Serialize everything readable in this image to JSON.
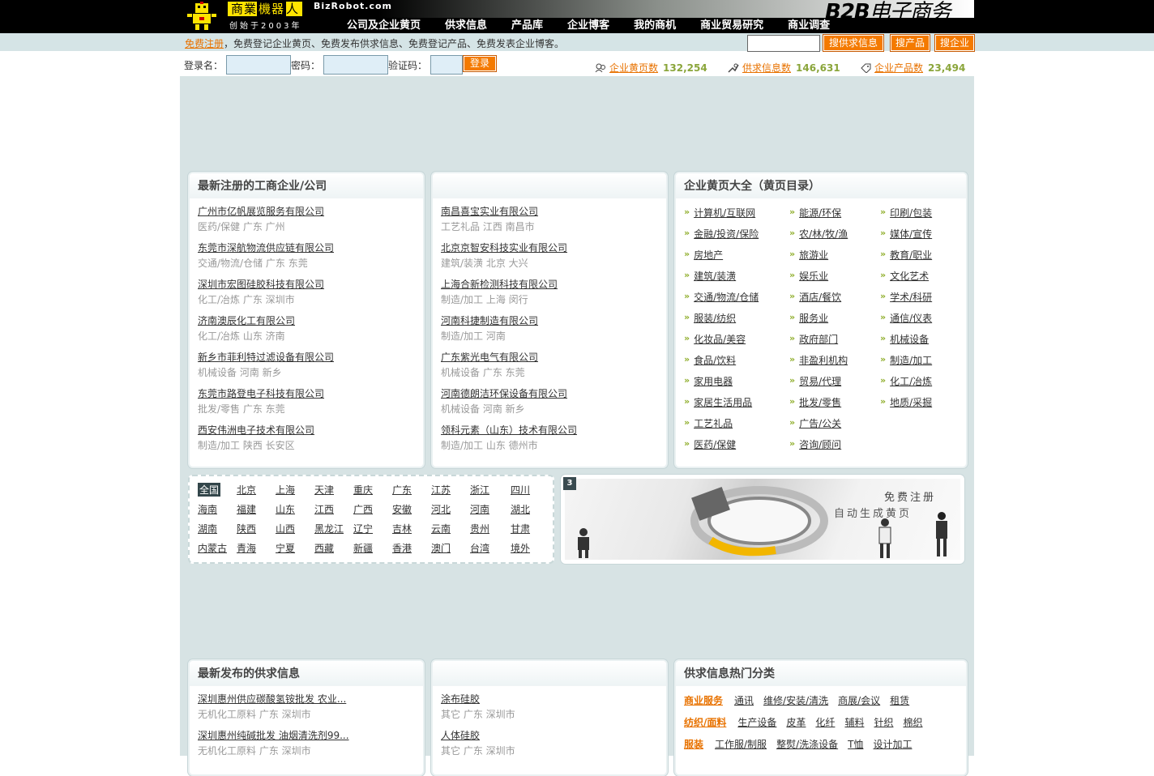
{
  "header": {
    "logo_cn_a": "商業",
    "logo_cn_b": "機器",
    "logo_cn_c": "人",
    "logo_en": "BizRobot.com",
    "logo_sub": "创始于2003年",
    "b2b_a": "B2B",
    "b2b_b": "电子商务",
    "nav": [
      "公司及企业黄页",
      "供求信息",
      "产品库",
      "企业博客",
      "我的商机",
      "商业贸易研究",
      "商业调查"
    ]
  },
  "subbar": {
    "register_link": "免费注册",
    "notice": "，免费登记企业黄页、免费发布供求信息、免费登记产品、免费发表企业博客。",
    "search_placeholder": "",
    "btn_supply": "搜供求信息",
    "btn_product": "搜产品",
    "btn_company": "搜企业"
  },
  "login": {
    "user_label": "登录名：",
    "pass_label": "密码：",
    "code_label": "验证码：",
    "button": "登录"
  },
  "stats": [
    {
      "label": "企业黄页数",
      "value": "132,254"
    },
    {
      "label": "供求信息数",
      "value": "146,631"
    },
    {
      "label": "企业产品数",
      "value": "23,494"
    }
  ],
  "new_companies": {
    "title": "最新注册的工商企业/公司",
    "col1": [
      {
        "name": "广州市亿帆展览服务有限公司",
        "meta": "医药/保健 广东 广州"
      },
      {
        "name": "东莞市深航物流供应链有限公司",
        "meta": "交通/物流/仓储 广东 东莞"
      },
      {
        "name": "深圳市宏图硅胶科技有限公司",
        "meta": "化工/冶炼 广东 深圳市"
      },
      {
        "name": "济南澳辰化工有限公司",
        "meta": "化工/冶炼 山东 济南"
      },
      {
        "name": "新乡市菲利特过滤设备有限公司",
        "meta": "机械设备 河南 新乡"
      },
      {
        "name": "东莞市路登电子科技有限公司",
        "meta": "批发/零售 广东 东莞"
      },
      {
        "name": "西安伟洲电子技术有限公司",
        "meta": "制造/加工 陕西 长安区"
      }
    ],
    "col2": [
      {
        "name": "南昌喜宝实业有限公司",
        "meta": "工艺礼品 江西 南昌市"
      },
      {
        "name": "北京京智安科技实业有限公司",
        "meta": "建筑/装潢 北京 大兴"
      },
      {
        "name": "上海合新检测科技有限公司",
        "meta": "制造/加工 上海 闵行"
      },
      {
        "name": "河南科捷制造有限公司",
        "meta": "制造/加工 河南"
      },
      {
        "name": "广东紫光电气有限公司",
        "meta": "机械设备 广东 东莞"
      },
      {
        "name": "河南德朗洁环保设备有限公司",
        "meta": "机械设备 河南 新乡"
      },
      {
        "name": "领科元素（山东）技术有限公司",
        "meta": "制造/加工 山东 德州市"
      }
    ]
  },
  "directory": {
    "title": "企业黄页大全（黄页目录）",
    "col1": [
      "计算机/互联网",
      "金融/投资/保险",
      "房地产",
      "建筑/装潢",
      "交通/物流/仓储",
      "服装/纺织",
      "化妆品/美容",
      "食品/饮料",
      "家用电器",
      "家居生活用品",
      "工艺礼品",
      "医药/保健"
    ],
    "col2": [
      "能源/环保",
      "农/林/牧/渔",
      "旅游业",
      "娱乐业",
      "酒店/餐饮",
      "服务业",
      "政府部门",
      "非盈利机构",
      "贸易/代理",
      "批发/零售",
      "广告/公关",
      "咨询/顾问"
    ],
    "col3": [
      "印刷/包装",
      "媒体/宣传",
      "教育/职业",
      "文化艺术",
      "学术/科研",
      "通信/仪表",
      "机械设备",
      "制造/加工",
      "化工/冶炼",
      "地质/采掘"
    ]
  },
  "regions": [
    [
      "全国",
      "北京",
      "上海",
      "天津",
      "重庆",
      "广东",
      "江苏",
      "浙江",
      "四川"
    ],
    [
      "海南",
      "福建",
      "山东",
      "江西",
      "广西",
      "安徽",
      "河北",
      "河南",
      "湖北"
    ],
    [
      "湖南",
      "陕西",
      "山西",
      "黑龙江",
      "辽宁",
      "吉林",
      "云南",
      "贵州",
      "甘肃"
    ],
    [
      "内蒙古",
      "青海",
      "宁夏",
      "西藏",
      "新疆",
      "香港",
      "澳门",
      "台湾",
      "境外"
    ]
  ],
  "banner": {
    "slide_number": "3",
    "text1": "免费注册",
    "text2": "自动生成黄页"
  },
  "supply": {
    "title": "最新发布的供求信息",
    "col1": [
      {
        "name": "深圳惠州供应碳酸氢铵批发 农业...",
        "meta": "无机化工原料 广东 深圳市"
      },
      {
        "name": "深圳惠州纯碱批发 油烟清洗剂99...",
        "meta": "无机化工原料 广东 深圳市"
      }
    ],
    "col2": [
      {
        "name": "涂布硅胶",
        "meta": "其它 广东 深圳市"
      },
      {
        "name": "人体硅胶",
        "meta": "其它 广东 深圳市"
      }
    ]
  },
  "hot": {
    "title": "供求信息热门分类",
    "rows": [
      {
        "head": "商业服务",
        "items": [
          "通讯",
          "维修/安装/清洗",
          "商展/会议",
          "租赁"
        ]
      },
      {
        "head": "纺织/面料",
        "items": [
          "生产设备",
          "皮革",
          "化纤",
          "辅料",
          "针织",
          "棉织"
        ]
      },
      {
        "head": "服装",
        "items": [
          "工作服/制服",
          "整熨/洗涤设备",
          "T恤",
          "设计加工"
        ]
      }
    ]
  },
  "colors": {
    "accent_orange": "#f47a00",
    "stat_green": "#8aa53a",
    "content_bg": "#d7e3e4"
  }
}
